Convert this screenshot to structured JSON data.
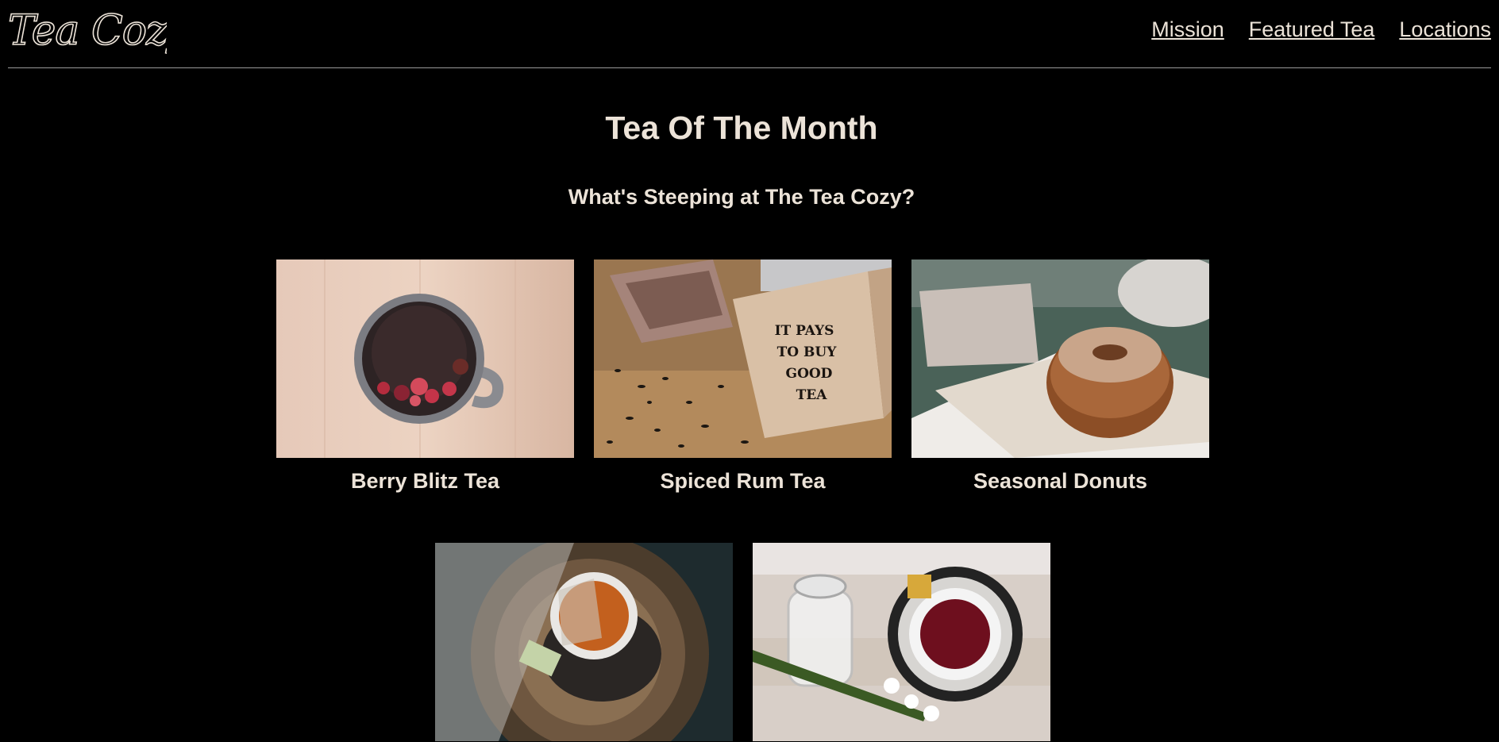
{
  "brand": {
    "logo_text": "Tea Cozy"
  },
  "nav": {
    "items": [
      {
        "label": "Mission"
      },
      {
        "label": "Featured Tea"
      },
      {
        "label": "Locations"
      }
    ]
  },
  "main": {
    "title": "Tea Of The Month",
    "subtitle": "What's Steeping at The Tea Cozy?",
    "cards": [
      {
        "caption": "Berry Blitz Tea"
      },
      {
        "caption": "Spiced Rum Tea",
        "box_text": [
          "IT PAYS",
          "TO BUY",
          "GOOD",
          "TEA"
        ]
      },
      {
        "caption": "Seasonal Donuts"
      },
      {
        "caption": ""
      },
      {
        "caption": ""
      }
    ]
  },
  "colors": {
    "background": "#000000",
    "text": "#ece3d8",
    "divider": "#9a9a9a"
  }
}
